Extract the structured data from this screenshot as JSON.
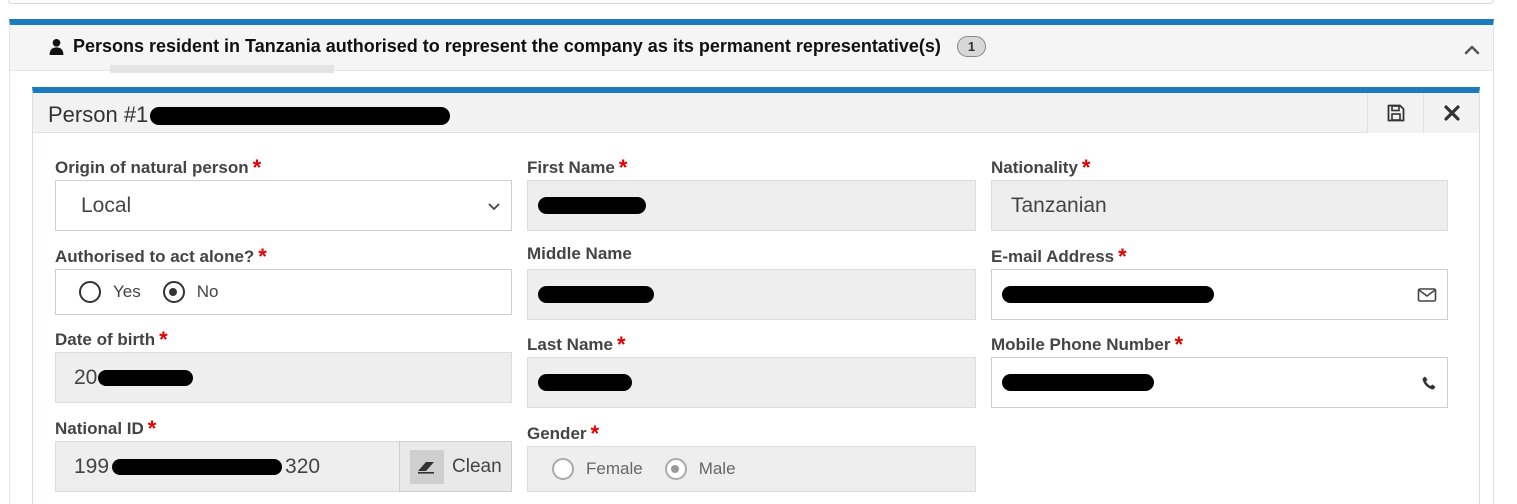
{
  "section": {
    "title": "Persons resident in Tanzania authorised to represent the company as its permanent representative(s)",
    "count_badge": "1",
    "icon": "user-icon",
    "collapse_icon": "chevron-up-icon"
  },
  "person_card": {
    "title_prefix": "Person #1",
    "save_icon": "save-icon",
    "close_icon": "close-icon"
  },
  "form": {
    "origin": {
      "label": "Origin of natural person",
      "value": "Local",
      "options": [
        "Local"
      ]
    },
    "authorised_alone": {
      "label": "Authorised to act alone?",
      "options": [
        "Yes",
        "No"
      ],
      "selected": "No"
    },
    "dob": {
      "label": "Date of birth",
      "visible_prefix": "20"
    },
    "national_id": {
      "label": "National ID",
      "visible_prefix": "199",
      "visible_suffix": "320",
      "clean_label": "Clean"
    },
    "first_name": {
      "label": "First Name"
    },
    "middle_name": {
      "label": "Middle Name"
    },
    "last_name": {
      "label": "Last Name"
    },
    "gender": {
      "label": "Gender",
      "options": [
        "Female",
        "Male"
      ],
      "selected": "Male"
    },
    "nationality": {
      "label": "Nationality",
      "value": "Tanzanian"
    },
    "email": {
      "label": "E-mail Address",
      "icon": "envelope-icon"
    },
    "mobile": {
      "label": "Mobile Phone Number",
      "icon": "phone-icon"
    }
  },
  "colors": {
    "accent": "#1a7bc0",
    "required": "#e00000",
    "readonly_bg": "#eeeeee"
  }
}
